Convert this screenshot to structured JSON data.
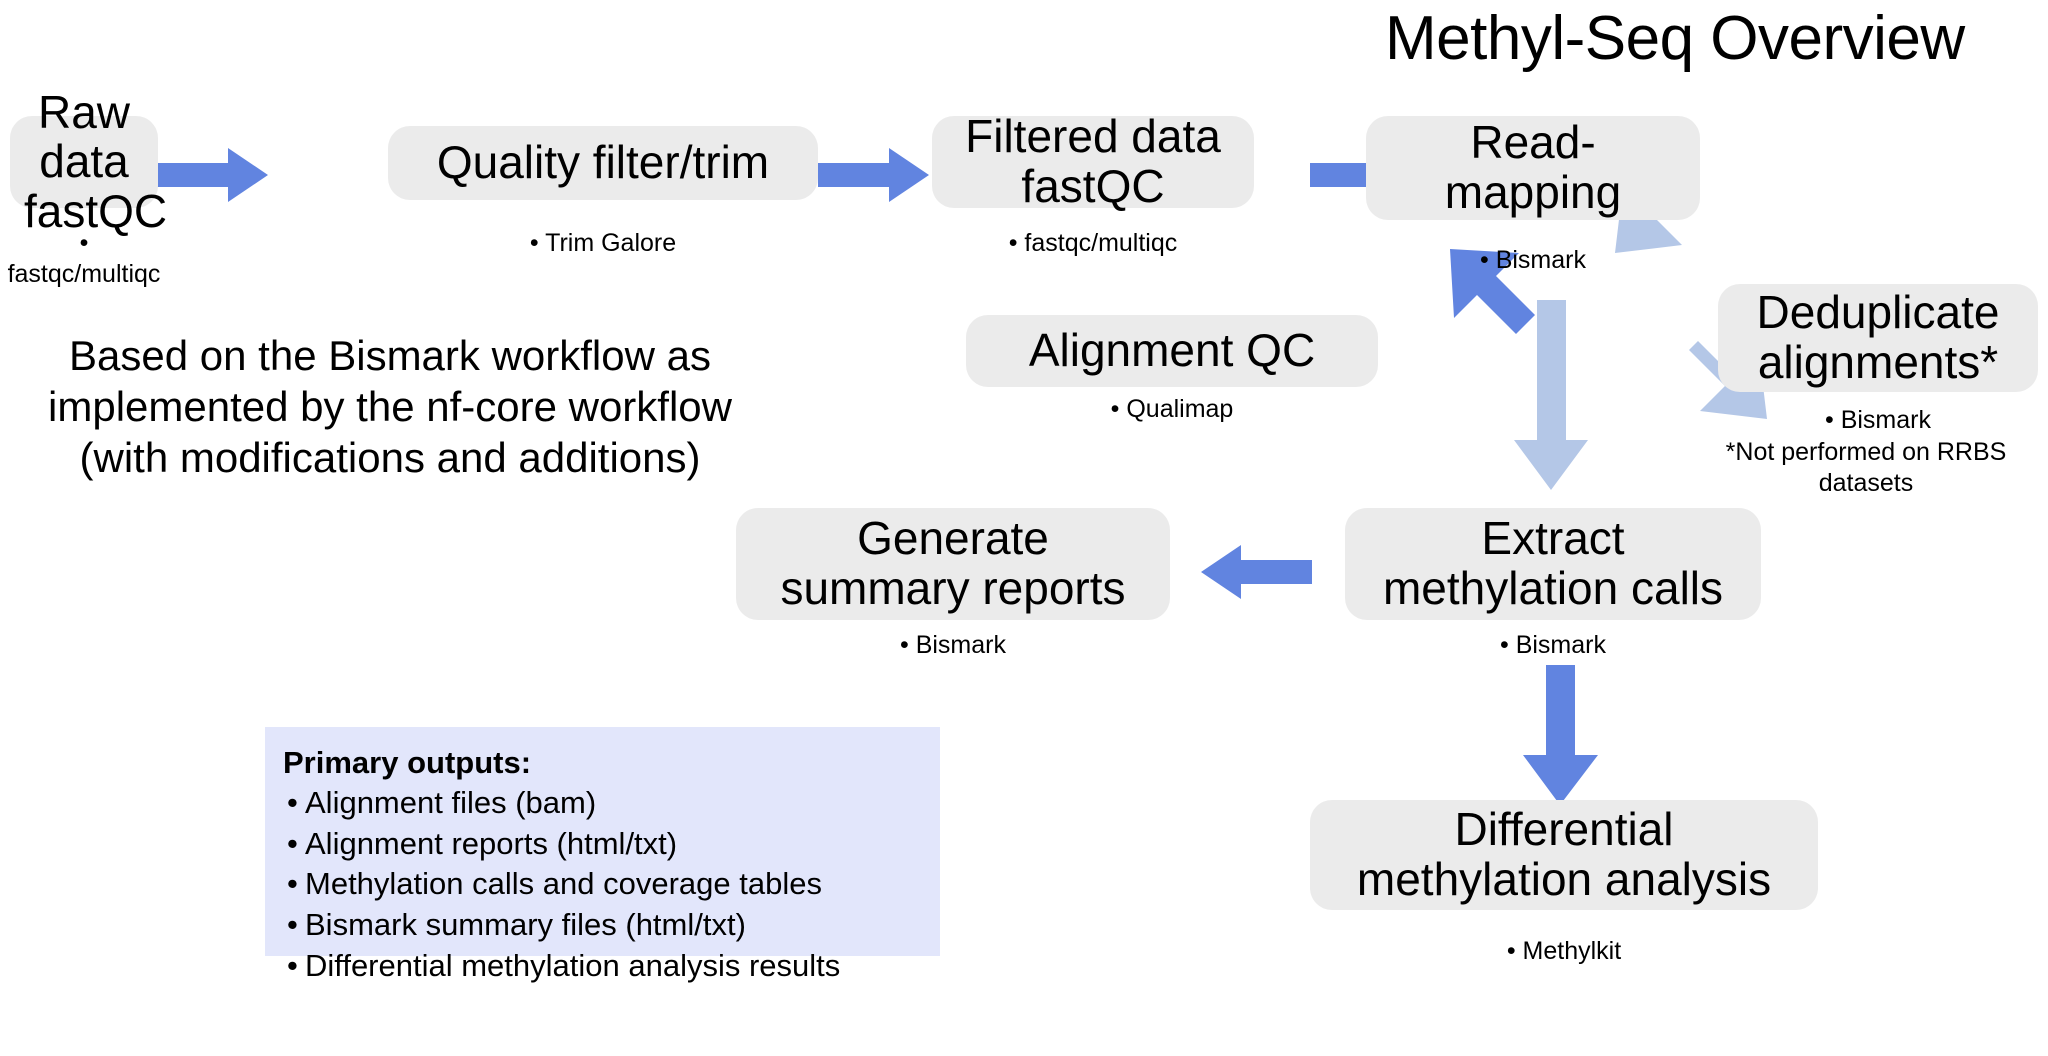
{
  "title": "Methyl-Seq Overview",
  "colors": {
    "box_fill": "#ebebeb",
    "arrow_primary": "#6184e0",
    "arrow_secondary": "#b4c7e7",
    "outputs_panel": "#e2e6fb",
    "text": "#000000",
    "page_background": "#ffffff"
  },
  "nodes": {
    "raw_data": {
      "label": "Raw data\nfastQC",
      "caption": "• fastqc/multiqc"
    },
    "quality_filter": {
      "label": "Quality filter/trim",
      "caption": "• Trim Galore"
    },
    "filtered_data": {
      "label": "Filtered data\nfastQC",
      "caption": "• fastqc/multiqc"
    },
    "read_mapping": {
      "label": "Read-\nmapping",
      "caption": "• Bismark"
    },
    "alignment_qc": {
      "label": "Alignment QC",
      "caption": "• Qualimap"
    },
    "deduplicate": {
      "label": "Deduplicate\nalignments*",
      "caption": "• Bismark",
      "footnote": "*Not performed on RRBS datasets"
    },
    "generate_reports": {
      "label": "Generate\nsummary reports",
      "caption": "• Bismark"
    },
    "extract_calls": {
      "label": "Extract\nmethylation calls",
      "caption": "• Bismark"
    },
    "differential": {
      "label": "Differential\nmethylation analysis",
      "caption": "• Methylkit"
    }
  },
  "note": {
    "text": "Based on the Bismark workflow as\nimplemented by the nf-core workflow\n(with modifications and additions)"
  },
  "outputs": {
    "title": "Primary outputs:",
    "items": [
      "Alignment files (bam)",
      "Alignment reports (html/txt)",
      "Methylation calls and coverage tables",
      "Bismark summary files (html/txt)",
      "Differential methylation analysis results"
    ]
  },
  "flow": {
    "edges": [
      {
        "from": "raw_data",
        "to": "quality_filter",
        "style": "primary",
        "direction": "right"
      },
      {
        "from": "quality_filter",
        "to": "filtered_data",
        "style": "primary",
        "direction": "right"
      },
      {
        "from": "filtered_data",
        "to": "read_mapping",
        "style": "primary",
        "direction": "right"
      },
      {
        "from": "read_mapping",
        "to": "alignment_qc",
        "style": "primary",
        "direction": "down-left"
      },
      {
        "from": "read_mapping",
        "to": "deduplicate",
        "style": "secondary",
        "direction": "down-right"
      },
      {
        "from": "read_mapping",
        "to": "extract_calls",
        "style": "secondary",
        "direction": "down"
      },
      {
        "from": "deduplicate",
        "to": "extract_calls",
        "style": "secondary",
        "direction": "down-left"
      },
      {
        "from": "extract_calls",
        "to": "generate_reports",
        "style": "primary",
        "direction": "left"
      },
      {
        "from": "extract_calls",
        "to": "differential",
        "style": "primary",
        "direction": "down"
      }
    ]
  }
}
